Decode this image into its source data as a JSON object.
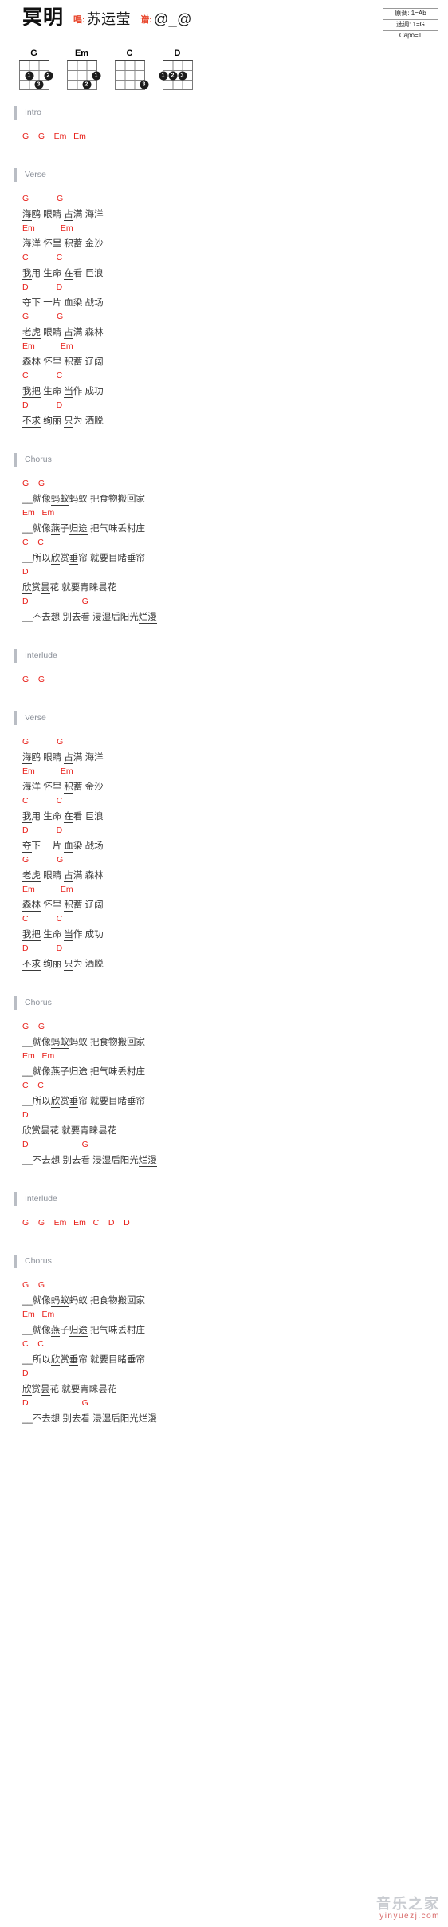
{
  "header": {
    "song_title": "冥明",
    "singer_label": "唱:",
    "singer_value": "苏运莹",
    "arranger_label": "谱:",
    "arranger_value": "@_@"
  },
  "key_box": {
    "original_key": "原调: 1=Ab",
    "selected_key": "选调: 1=G",
    "capo": "Capo=1"
  },
  "chord_diagrams": [
    {
      "name": "G",
      "dots": [
        {
          "string": 2,
          "fret": 2,
          "finger": "1"
        },
        {
          "string": 4,
          "fret": 2,
          "finger": "2"
        },
        {
          "string": 3,
          "fret": 3,
          "finger": "3"
        }
      ]
    },
    {
      "name": "Em",
      "dots": [
        {
          "string": 4,
          "fret": 2,
          "finger": "1"
        },
        {
          "string": 3,
          "fret": 3,
          "finger": "2"
        }
      ]
    },
    {
      "name": "C",
      "dots": [
        {
          "string": 4,
          "fret": 3,
          "finger": "3"
        }
      ]
    },
    {
      "name": "D",
      "dots": [
        {
          "string": 1,
          "fret": 2,
          "finger": "1"
        },
        {
          "string": 2,
          "fret": 2,
          "finger": "2"
        },
        {
          "string": 3,
          "fret": 2,
          "finger": "3"
        }
      ]
    }
  ],
  "sections": [
    {
      "name": "Intro",
      "lines": [
        {
          "type": "chord",
          "text": "G    G    Em   Em"
        }
      ]
    },
    {
      "name": "Verse",
      "lines": [
        {
          "type": "chord",
          "text": "G            G"
        },
        {
          "type": "lyric",
          "segments": [
            {
              "t": "海",
              "u": true
            },
            {
              "t": "鸥 ",
              "u": false
            },
            {
              "t": "眼睛 ",
              "u": false
            },
            {
              "t": "占",
              "u": true
            },
            {
              "t": "满 ",
              "u": false
            },
            {
              "t": "海洋",
              "u": false
            }
          ]
        },
        {
          "type": "chord",
          "text": "Em           Em"
        },
        {
          "type": "lyric",
          "segments": [
            {
              "t": "海洋 ",
              "u": false
            },
            {
              "t": "怀里 ",
              "u": false
            },
            {
              "t": "积",
              "u": true
            },
            {
              "t": "蓄 ",
              "u": false
            },
            {
              "t": "金沙",
              "u": false
            }
          ]
        },
        {
          "type": "chord",
          "text": "C            C"
        },
        {
          "type": "lyric",
          "segments": [
            {
              "t": "我",
              "u": true
            },
            {
              "t": "用 ",
              "u": false
            },
            {
              "t": "生命 ",
              "u": false
            },
            {
              "t": "在",
              "u": true
            },
            {
              "t": "看 ",
              "u": false
            },
            {
              "t": "巨浪",
              "u": false
            }
          ]
        },
        {
          "type": "chord",
          "text": "D            D"
        },
        {
          "type": "lyric",
          "segments": [
            {
              "t": "夺",
              "u": true
            },
            {
              "t": "下 ",
              "u": false
            },
            {
              "t": "一片 ",
              "u": false
            },
            {
              "t": "血",
              "u": true
            },
            {
              "t": "染 ",
              "u": false
            },
            {
              "t": "战场",
              "u": false
            }
          ]
        },
        {
          "type": "chord",
          "text": "G            G"
        },
        {
          "type": "lyric",
          "segments": [
            {
              "t": "老虎",
              "u": true
            },
            {
              "t": " 眼睛 ",
              "u": false
            },
            {
              "t": "占",
              "u": true
            },
            {
              "t": "满 ",
              "u": false
            },
            {
              "t": "森林",
              "u": false
            }
          ]
        },
        {
          "type": "chord",
          "text": "Em           Em"
        },
        {
          "type": "lyric",
          "segments": [
            {
              "t": "森林",
              "u": true
            },
            {
              "t": " 怀里 ",
              "u": false
            },
            {
              "t": "积",
              "u": true
            },
            {
              "t": "蓄 ",
              "u": false
            },
            {
              "t": "辽阔",
              "u": false
            }
          ]
        },
        {
          "type": "chord",
          "text": "C            C"
        },
        {
          "type": "lyric",
          "segments": [
            {
              "t": "我把",
              "u": true
            },
            {
              "t": " 生命 ",
              "u": false
            },
            {
              "t": "当",
              "u": true
            },
            {
              "t": "作 ",
              "u": false
            },
            {
              "t": "成功",
              "u": false
            }
          ]
        },
        {
          "type": "chord",
          "text": "D            D"
        },
        {
          "type": "lyric",
          "segments": [
            {
              "t": "不求",
              "u": true
            },
            {
              "t": " 绚丽 ",
              "u": false
            },
            {
              "t": "只",
              "u": true
            },
            {
              "t": "为 ",
              "u": false
            },
            {
              "t": "洒脱",
              "u": false
            }
          ]
        }
      ]
    },
    {
      "name": "Chorus",
      "lines": [
        {
          "type": "chord",
          "text": "G    G"
        },
        {
          "type": "lyric",
          "segments": [
            {
              "t": "__就像",
              "u": false
            },
            {
              "t": "蚂蚁",
              "u": true
            },
            {
              "t": "蚂蚁 ",
              "u": false
            },
            {
              "t": "把食物搬回家",
              "u": false
            }
          ]
        },
        {
          "type": "chord",
          "text": "Em   Em"
        },
        {
          "type": "lyric",
          "segments": [
            {
              "t": "__就像",
              "u": false
            },
            {
              "t": "燕",
              "u": true
            },
            {
              "t": "子",
              "u": false
            },
            {
              "t": "归途",
              "u": true
            },
            {
              "t": " 把气味丢村庄",
              "u": false
            }
          ]
        },
        {
          "type": "chord",
          "text": "C    C"
        },
        {
          "type": "lyric",
          "segments": [
            {
              "t": "__所以",
              "u": false
            },
            {
              "t": "欣",
              "u": true
            },
            {
              "t": "赏",
              "u": false
            },
            {
              "t": "垂",
              "u": true
            },
            {
              "t": "帘 ",
              "u": false
            },
            {
              "t": "就要目睹垂帘",
              "u": false
            }
          ]
        },
        {
          "type": "chord",
          "text": "D"
        },
        {
          "type": "lyric",
          "segments": [
            {
              "t": "欣",
              "u": true
            },
            {
              "t": "赏",
              "u": false
            },
            {
              "t": "昙",
              "u": true
            },
            {
              "t": "花 ",
              "u": false
            },
            {
              "t": "就要青睐昙花",
              "u": false
            }
          ]
        },
        {
          "type": "chord",
          "text": "D                       G"
        },
        {
          "type": "lyric",
          "segments": [
            {
              "t": "__不去想 ",
              "u": false
            },
            {
              "t": "别去看 ",
              "u": false
            },
            {
              "t": "浸湿后阳光",
              "u": false
            },
            {
              "t": "烂漫",
              "u": true
            }
          ]
        }
      ]
    },
    {
      "name": "Interlude",
      "lines": [
        {
          "type": "chord",
          "text": "G    G"
        }
      ]
    },
    {
      "name": "Verse",
      "lines": [
        {
          "type": "chord",
          "text": "G            G"
        },
        {
          "type": "lyric",
          "segments": [
            {
              "t": "海",
              "u": true
            },
            {
              "t": "鸥 ",
              "u": false
            },
            {
              "t": "眼睛 ",
              "u": false
            },
            {
              "t": "占",
              "u": true
            },
            {
              "t": "满 ",
              "u": false
            },
            {
              "t": "海洋",
              "u": false
            }
          ]
        },
        {
          "type": "chord",
          "text": "Em           Em"
        },
        {
          "type": "lyric",
          "segments": [
            {
              "t": "海洋 ",
              "u": false
            },
            {
              "t": "怀里 ",
              "u": false
            },
            {
              "t": "积",
              "u": true
            },
            {
              "t": "蓄 ",
              "u": false
            },
            {
              "t": "金沙",
              "u": false
            }
          ]
        },
        {
          "type": "chord",
          "text": "C            C"
        },
        {
          "type": "lyric",
          "segments": [
            {
              "t": "我",
              "u": true
            },
            {
              "t": "用 ",
              "u": false
            },
            {
              "t": "生命 ",
              "u": false
            },
            {
              "t": "在",
              "u": true
            },
            {
              "t": "看 ",
              "u": false
            },
            {
              "t": "巨浪",
              "u": false
            }
          ]
        },
        {
          "type": "chord",
          "text": "D            D"
        },
        {
          "type": "lyric",
          "segments": [
            {
              "t": "夺",
              "u": true
            },
            {
              "t": "下 ",
              "u": false
            },
            {
              "t": "一片 ",
              "u": false
            },
            {
              "t": "血",
              "u": true
            },
            {
              "t": "染 ",
              "u": false
            },
            {
              "t": "战场",
              "u": false
            }
          ]
        },
        {
          "type": "chord",
          "text": "G            G"
        },
        {
          "type": "lyric",
          "segments": [
            {
              "t": "老虎",
              "u": true
            },
            {
              "t": " 眼睛 ",
              "u": false
            },
            {
              "t": "占",
              "u": true
            },
            {
              "t": "满 ",
              "u": false
            },
            {
              "t": "森林",
              "u": false
            }
          ]
        },
        {
          "type": "chord",
          "text": "Em           Em"
        },
        {
          "type": "lyric",
          "segments": [
            {
              "t": "森林",
              "u": true
            },
            {
              "t": " 怀里 ",
              "u": false
            },
            {
              "t": "积",
              "u": true
            },
            {
              "t": "蓄 ",
              "u": false
            },
            {
              "t": "辽阔",
              "u": false
            }
          ]
        },
        {
          "type": "chord",
          "text": "C            C"
        },
        {
          "type": "lyric",
          "segments": [
            {
              "t": "我把",
              "u": true
            },
            {
              "t": " 生命 ",
              "u": false
            },
            {
              "t": "当",
              "u": true
            },
            {
              "t": "作 ",
              "u": false
            },
            {
              "t": "成功",
              "u": false
            }
          ]
        },
        {
          "type": "chord",
          "text": "D            D"
        },
        {
          "type": "lyric",
          "segments": [
            {
              "t": "不求",
              "u": true
            },
            {
              "t": " 绚丽 ",
              "u": false
            },
            {
              "t": "只",
              "u": true
            },
            {
              "t": "为 ",
              "u": false
            },
            {
              "t": "洒脱",
              "u": false
            }
          ]
        }
      ]
    },
    {
      "name": "Chorus",
      "lines": [
        {
          "type": "chord",
          "text": "G    G"
        },
        {
          "type": "lyric",
          "segments": [
            {
              "t": "__就像",
              "u": false
            },
            {
              "t": "蚂蚁",
              "u": true
            },
            {
              "t": "蚂蚁 ",
              "u": false
            },
            {
              "t": "把食物搬回家",
              "u": false
            }
          ]
        },
        {
          "type": "chord",
          "text": "Em   Em"
        },
        {
          "type": "lyric",
          "segments": [
            {
              "t": "__就像",
              "u": false
            },
            {
              "t": "燕",
              "u": true
            },
            {
              "t": "子",
              "u": false
            },
            {
              "t": "归途",
              "u": true
            },
            {
              "t": " 把气味丢村庄",
              "u": false
            }
          ]
        },
        {
          "type": "chord",
          "text": "C    C"
        },
        {
          "type": "lyric",
          "segments": [
            {
              "t": "__所以",
              "u": false
            },
            {
              "t": "欣",
              "u": true
            },
            {
              "t": "赏",
              "u": false
            },
            {
              "t": "垂",
              "u": true
            },
            {
              "t": "帘 ",
              "u": false
            },
            {
              "t": "就要目睹垂帘",
              "u": false
            }
          ]
        },
        {
          "type": "chord",
          "text": "D"
        },
        {
          "type": "lyric",
          "segments": [
            {
              "t": "欣",
              "u": true
            },
            {
              "t": "赏",
              "u": false
            },
            {
              "t": "昙",
              "u": true
            },
            {
              "t": "花 ",
              "u": false
            },
            {
              "t": "就要青睐昙花",
              "u": false
            }
          ]
        },
        {
          "type": "chord",
          "text": "D                       G"
        },
        {
          "type": "lyric",
          "segments": [
            {
              "t": "__不去想 ",
              "u": false
            },
            {
              "t": "别去看 ",
              "u": false
            },
            {
              "t": "浸湿后阳光",
              "u": false
            },
            {
              "t": "烂漫",
              "u": true
            }
          ]
        }
      ]
    },
    {
      "name": "Interlude",
      "lines": [
        {
          "type": "chord",
          "text": "G    G    Em   Em   C    D    D"
        }
      ]
    },
    {
      "name": "Chorus",
      "lines": [
        {
          "type": "chord",
          "text": "G    G"
        },
        {
          "type": "lyric",
          "segments": [
            {
              "t": "__就像",
              "u": false
            },
            {
              "t": "蚂蚁",
              "u": true
            },
            {
              "t": "蚂蚁 ",
              "u": false
            },
            {
              "t": "把食物搬回家",
              "u": false
            }
          ]
        },
        {
          "type": "chord",
          "text": "Em   Em"
        },
        {
          "type": "lyric",
          "segments": [
            {
              "t": "__就像",
              "u": false
            },
            {
              "t": "燕",
              "u": true
            },
            {
              "t": "子",
              "u": false
            },
            {
              "t": "归途",
              "u": true
            },
            {
              "t": " 把气味丢村庄",
              "u": false
            }
          ]
        },
        {
          "type": "chord",
          "text": "C    C"
        },
        {
          "type": "lyric",
          "segments": [
            {
              "t": "__所以",
              "u": false
            },
            {
              "t": "欣",
              "u": true
            },
            {
              "t": "赏",
              "u": false
            },
            {
              "t": "垂",
              "u": true
            },
            {
              "t": "帘 ",
              "u": false
            },
            {
              "t": "就要目睹垂帘",
              "u": false
            }
          ]
        },
        {
          "type": "chord",
          "text": "D"
        },
        {
          "type": "lyric",
          "segments": [
            {
              "t": "欣",
              "u": true
            },
            {
              "t": "赏",
              "u": false
            },
            {
              "t": "昙",
              "u": true
            },
            {
              "t": "花 ",
              "u": false
            },
            {
              "t": "就要青睐昙花",
              "u": false
            }
          ]
        },
        {
          "type": "chord",
          "text": "D                       G"
        },
        {
          "type": "lyric",
          "segments": [
            {
              "t": "__不去想 ",
              "u": false
            },
            {
              "t": "别去看 ",
              "u": false
            },
            {
              "t": "浸湿后阳光",
              "u": false
            },
            {
              "t": "烂漫",
              "u": true
            }
          ]
        }
      ]
    }
  ],
  "watermark": {
    "main": "音乐之家",
    "sub": "yinyuezj.com"
  }
}
